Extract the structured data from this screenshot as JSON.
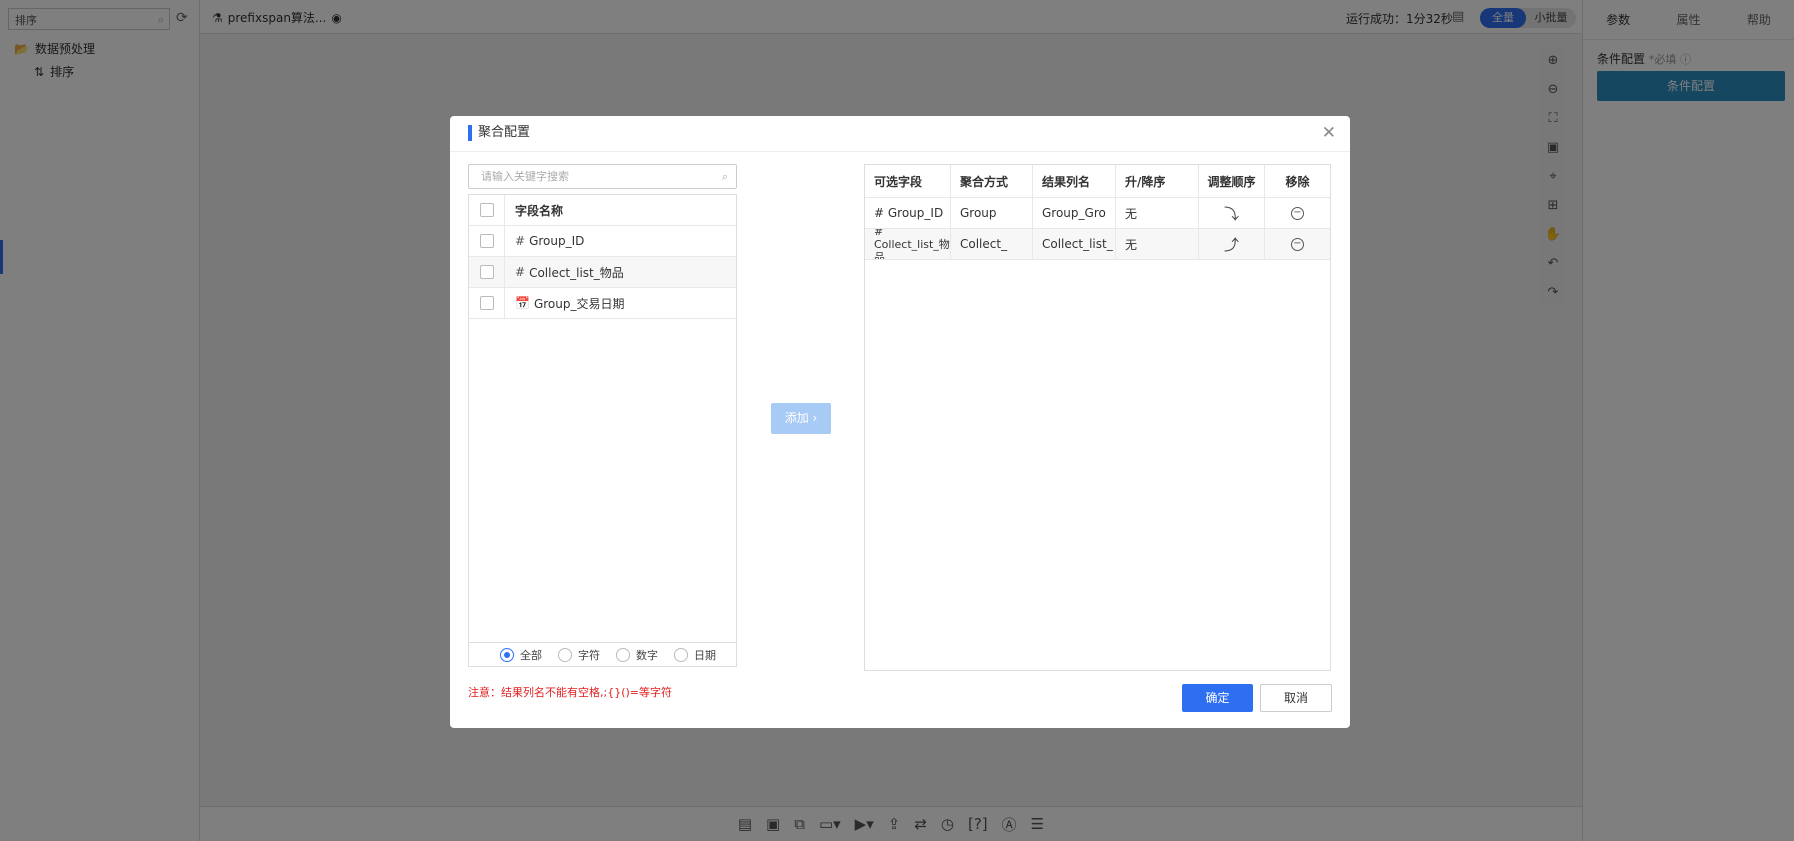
{
  "left_panel": {
    "search_value": "排序",
    "tree_root": "数据预处理",
    "tree_child": "排序"
  },
  "topbar": {
    "tab_title": "prefixspan算法...",
    "run_status": "运行成功：1分32秒",
    "toggle_all": "全量",
    "toggle_small": "小批量"
  },
  "right_panel": {
    "tabs": [
      "参数",
      "属性",
      "帮助"
    ],
    "condition_label": "条件配置",
    "required_label": "*必填",
    "condition_button": "条件配置"
  },
  "modal": {
    "title": "聚合配置",
    "search_placeholder": "请输入关键字搜索",
    "field_list_header": "字段名称",
    "fields": [
      {
        "type": "#",
        "name": "Group_ID"
      },
      {
        "type": "#",
        "name": "Collect_list_物品"
      },
      {
        "type": "📅",
        "name": "Group_交易日期"
      }
    ],
    "filters": [
      "全部",
      "字符",
      "数字",
      "日期"
    ],
    "selected_filter": "全部",
    "add_button": "添加 ›",
    "table": {
      "headers": [
        "可选字段",
        "聚合方式",
        "结果列名",
        "升/降序",
        "调整顺序",
        "移除"
      ],
      "rows": [
        {
          "field": "# Group_ID",
          "method": "Group",
          "result": "Group_Gro",
          "order": "无",
          "adjust": "⤵"
        },
        {
          "field": "# Collect_list_物品",
          "method": "Collect_",
          "result": "Collect_list_",
          "order": "无",
          "adjust": "⤴"
        }
      ]
    },
    "note": "注意：结果列名不能有空格,;{}()=等字符",
    "ok_button": "确定",
    "cancel_button": "取消"
  },
  "colors": {
    "primary": "#2e6ff2",
    "condition_button": "#2a8ec2",
    "warning": "#e02020",
    "add_disabled": "#a7cbf4"
  }
}
